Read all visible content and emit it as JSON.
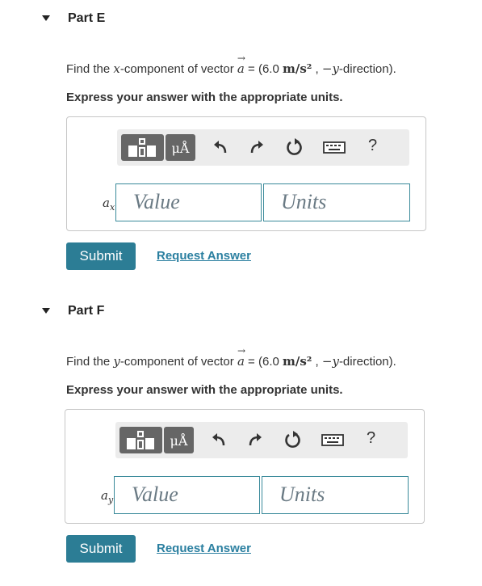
{
  "parts": [
    {
      "title": "Part E",
      "question_pre": "Find the ",
      "component_var": "x",
      "question_mid": "-component of vector ",
      "vector": "a",
      "question_eq": " = (6.0 ",
      "unit": "m/s²",
      "question_sep": " , ",
      "direction": "−y",
      "question_post": "-direction).",
      "instruction": "Express your answer with the appropriate units.",
      "answer_label_var": "a",
      "answer_label_sub": "x",
      "answer_label_eq": " =",
      "value_placeholder": "Value",
      "units_placeholder": "Units",
      "submit_label": "Submit",
      "request_label": "Request Answer"
    },
    {
      "title": "Part F",
      "question_pre": "Find the ",
      "component_var": "y",
      "question_mid": "-component of vector ",
      "vector": "a",
      "question_eq": " = (6.0 ",
      "unit": "m/s²",
      "question_sep": " , ",
      "direction": "−y",
      "question_post": "-direction).",
      "instruction": "Express your answer with the appropriate units.",
      "answer_label_var": "a",
      "answer_label_sub": "y",
      "answer_label_eq": " =",
      "value_placeholder": "Value",
      "units_placeholder": "Units",
      "submit_label": "Submit",
      "request_label": "Request Answer"
    }
  ],
  "toolbar": {
    "units_button_label": "μÅ",
    "help_label": "?",
    "icons": [
      "templates-icon",
      "units-icon",
      "undo-icon",
      "redo-icon",
      "reset-icon",
      "keyboard-icon",
      "help-icon"
    ]
  },
  "colors": {
    "submit": "#2c7d95",
    "link": "#2a7fa0",
    "field_border": "#3a8a9a",
    "toolbar_bg": "#ececec",
    "toolbar_button": "#666666"
  }
}
